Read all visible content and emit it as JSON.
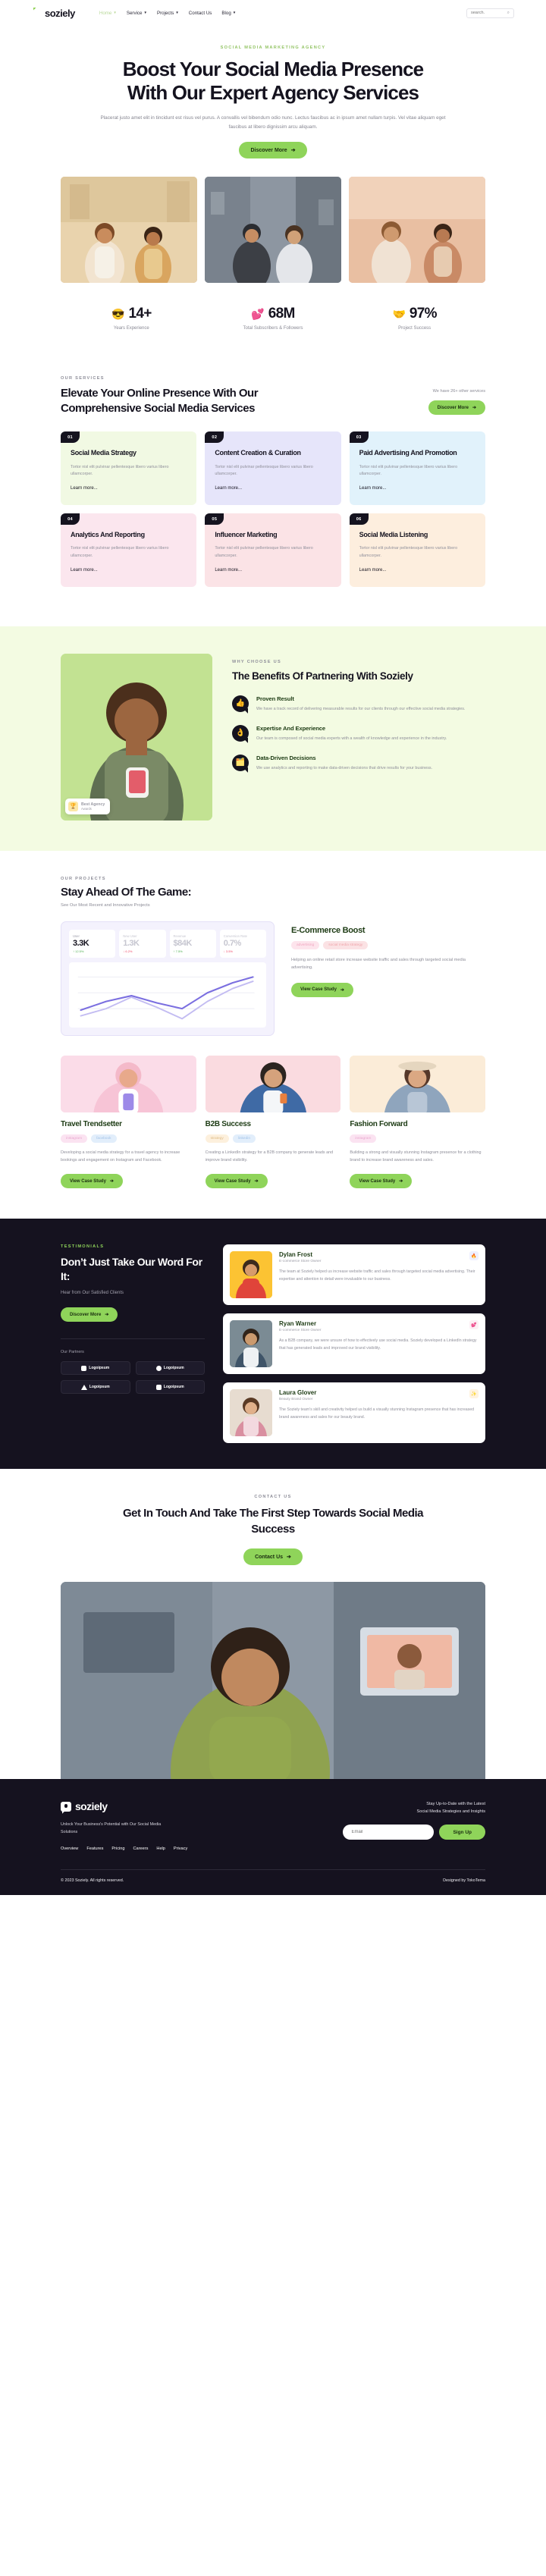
{
  "brand": {
    "name": "soziely",
    "icon": "chat-bubble-icon"
  },
  "nav": {
    "links": [
      {
        "label": "Home",
        "has_caret": true,
        "active": true
      },
      {
        "label": "Service",
        "has_caret": true,
        "active": false
      },
      {
        "label": "Projects",
        "has_caret": true,
        "active": false
      },
      {
        "label": "Contact Us",
        "has_caret": false,
        "active": false
      },
      {
        "label": "Blog",
        "has_caret": true,
        "active": false
      }
    ],
    "search_placeholder": "search.",
    "search_value": ""
  },
  "hero": {
    "eyebrow": "SOCIAL MEDIA MARKETING AGENCY",
    "title_line1": "Boost Your Social Media Presence",
    "title_line2": "With Our Expert Agency Services",
    "paragraph": "Placerat justo amet elit in tincidunt est risus vel purus. A convallis vel bibendum odio nunc. Lectus faucibus ac in ipsum amet nullam turpis. Vel vitae aliquam eget faucibus at libero dignissim arcu aliquam.",
    "cta": "Discover More"
  },
  "stats": [
    {
      "emoji": "😎",
      "value": "14+",
      "label": "Years Experience"
    },
    {
      "emoji": "💕",
      "value": "68M",
      "label": "Total Subscribers & Followers"
    },
    {
      "emoji": "🤝",
      "value": "97%",
      "label": "Project Success"
    }
  ],
  "services": {
    "eyebrow": "OUR SERVICES",
    "title": "Elevate Your Online Presence With Our Comprehensive Social Media Services",
    "note": "We have 26+ other services",
    "cta": "Discover More",
    "cards": [
      {
        "num": "01",
        "title": "Social Media Strategy",
        "desc": "Tortor nisl elit pulvinar pellentesque libero varius libero ullamcorper.",
        "link": "Learn more..."
      },
      {
        "num": "02",
        "title": "Content Creation & Curation",
        "desc": "Tortor nisl elit pulvinar pellentesque libero varius libero ullamcorper.",
        "link": "Learn more..."
      },
      {
        "num": "03",
        "title": "Paid Advertising And Promotion",
        "desc": "Tortor nisl elit pulvinar pellentesque libero varius libero ullamcorper.",
        "link": "Learn more..."
      },
      {
        "num": "04",
        "title": "Analytics And Reporting",
        "desc": "Tortor nisl elit pulvinar pellentesque libero varius libero ullamcorper.",
        "link": "Learn more..."
      },
      {
        "num": "05",
        "title": "Influencer Marketing",
        "desc": "Tortor nisl elit pulvinar pellentesque libero varius libero ullamcorper.",
        "link": "Learn more..."
      },
      {
        "num": "06",
        "title": "Social Media Listening",
        "desc": "Tortor nisl elit pulvinar pellentesque libero varius libero ullamcorper.",
        "link": "Learn more..."
      }
    ]
  },
  "benefits": {
    "eyebrow": "WHY CHOOSE US",
    "title": "The Benefits Of Partnering With Soziely",
    "badge": {
      "title": "Best Agency",
      "subtitle": "Awards",
      "emoji": "🏆"
    },
    "items": [
      {
        "emoji": "👍",
        "title": "Proven Result",
        "desc": "We have a track record of delivering measurable results for our clients through our effective social media strategies."
      },
      {
        "emoji": "👌",
        "title": "Expertise And Experience",
        "desc": "Our team is composed of social media experts with a wealth of knowledge and experience in the industry."
      },
      {
        "emoji": "🗂️",
        "title": "Data-Driven Decisions",
        "desc": "We use analytics and reporting to make data-driven decisions that drive results for your business."
      }
    ]
  },
  "projects": {
    "eyebrow": "OUR PROJECTS",
    "title": "Stay Ahead Of The Game:",
    "subtitle": "See Our Most Recent and Innovative Projects",
    "featured": {
      "title": "E-Commerce Boost",
      "tags": [
        {
          "label": "advertising",
          "color": "pink"
        },
        {
          "label": "social media strategy",
          "color": "rose"
        }
      ],
      "desc": "Helping an online retail store increase website traffic and sales through targeted social media advertising.",
      "cta": "View Case Study",
      "kpis": [
        {
          "label": "User",
          "value": "3.3K",
          "delta": "↑ 12.5%",
          "dir": "up",
          "active": true
        },
        {
          "label": "New User",
          "value": "1.3K",
          "delta": "↓ 6.2%",
          "dir": "down",
          "active": false
        },
        {
          "label": "Revenue",
          "value": "$84K",
          "delta": "↑ 7.5%",
          "dir": "up",
          "active": false
        },
        {
          "label": "Conversion Rate",
          "value": "0.7%",
          "delta": "↓ 3.5%",
          "dir": "down",
          "active": false
        }
      ]
    },
    "cards": [
      {
        "title": "Travel Trendsetter",
        "tags": [
          {
            "label": "instagram",
            "color": "lilac"
          },
          {
            "label": "facebook",
            "color": "blue"
          }
        ],
        "desc": "Developing a social media strategy for a travel agency to increase bookings and engagement on Instagram and Facebook.",
        "cta": "View Case Study"
      },
      {
        "title": "B2B Success",
        "tags": [
          {
            "label": "strategy",
            "color": "cream"
          },
          {
            "label": "linkedin",
            "color": "blue"
          }
        ],
        "desc": "Creating a LinkedIn strategy for a B2B company to generate leads and improve brand visibility.",
        "cta": "View Case Study"
      },
      {
        "title": "Fashion Forward",
        "tags": [
          {
            "label": "instagram",
            "color": "lilac"
          }
        ],
        "desc": "Building a strong and visually stunning Instagram presence for a clothing brand to increase brand awareness and sales.",
        "cta": "View Case Study"
      }
    ]
  },
  "testimonials": {
    "eyebrow": "TESTIMONIALS",
    "title": "Don’t Just Take Our Word For It:",
    "subtitle": "Hear from Our Satisfied Clients",
    "cta": "Discover More",
    "partners_label": "Our Partners",
    "partners": [
      {
        "name": "Logoipsum",
        "mark": "square"
      },
      {
        "name": "Logoipsum",
        "mark": "circle"
      },
      {
        "name": "Logoipsum",
        "mark": "triangle"
      },
      {
        "name": "Logoipsum",
        "mark": "square"
      }
    ],
    "cards": [
      {
        "name": "Dylan Frost",
        "role": "E-commerce Store Owner",
        "badge": "🔥",
        "quote": "The team at Soziely helped us increase website traffic and sales through targeted social media advertising. Their expertise and attention to detail were invaluable to our business."
      },
      {
        "name": "Ryan Warner",
        "role": "E-commerce Store Owner",
        "badge": "💕",
        "quote": "As a B2B company, we were unsure of how to effectively use social media. Soziely developed a LinkedIn strategy that has generated leads and improved our brand visibility."
      },
      {
        "name": "Laura Glover",
        "role": "Beauty Brand Owner",
        "badge": "✨",
        "quote": "The Soziely team's skill and creativity helped us build a visually stunning Instagram presence that has increased brand awareness and sales for our beauty brand."
      }
    ]
  },
  "contact": {
    "eyebrow": "CONTACT US",
    "title": "Get In Touch And Take The First Step Towards Social Media Success",
    "cta": "Contact Us"
  },
  "footer": {
    "brand": "soziely",
    "tagline": "Unlock Your Business's Potential with Our Social Media Solutions",
    "links": [
      "Overview",
      "Features",
      "Pricing",
      "Careers",
      "Help",
      "Privacy"
    ],
    "newsletter_line1": "Stay Up-to-Date with the Latest",
    "newsletter_line2": "Social Media Strategies and Insights",
    "email_placeholder": "Email",
    "email_value": "",
    "signup": "Sign Up",
    "copyright": "© 2023 Soziely. All rights reserved.",
    "designed_by": "Designed by TokoTema"
  },
  "colors": {
    "accent_green": "#8fd45a",
    "dark": "#15121f",
    "light_green_bg": "#f3fbe2"
  }
}
